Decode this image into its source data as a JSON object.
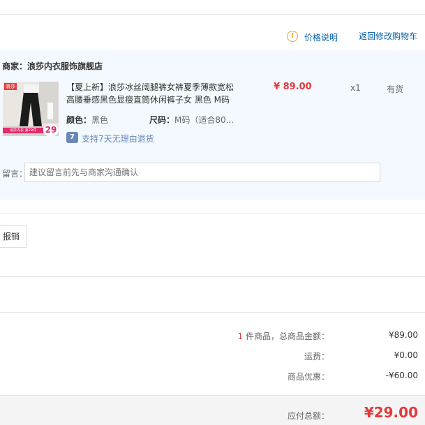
{
  "header": {
    "price_info_label": "价格说明",
    "back_to_cart_label": "返回修改购物车"
  },
  "store": {
    "merchant_label": "商家：",
    "merchant_name": "浪莎内衣服饰旗舰店",
    "product": {
      "title_line1": "【夏上新】浪莎冰丝阔腿裤女裤夏季薄款宽松",
      "title_line2": "高腰垂感黑色显瘦直筒休闲裤子女 黑色 M码",
      "price": "¥ 89.00",
      "quantity": "x1",
      "stock": "有货",
      "color_label": "颜色：",
      "color_value": "黑色",
      "size_label": "尺码：",
      "size_value": "M码（适合80...",
      "return_policy": "支持7天无理由退货",
      "thumb_badge": "29",
      "thumb_banner": "浪莎内衣 第29件",
      "thumb_logo": "浪莎"
    },
    "note_label": "留言：",
    "note_placeholder": "建议留言前先与商家沟通确认"
  },
  "invoice_button": "报销",
  "summary": {
    "count": "1",
    "count_suffix": " 件商品，总商品金额：",
    "goods_total": "¥89.00",
    "shipping_label": "运费：",
    "shipping_value": "¥0.00",
    "discount_label": "商品优惠：",
    "discount_value": "-¥60.00"
  },
  "footer": {
    "payable_label": "应付总额：",
    "payable_value": "¥29.00"
  },
  "colors": {
    "accent_red": "#e4393c",
    "link_blue": "#005ea7",
    "panel_bg": "#f3f9fe"
  }
}
